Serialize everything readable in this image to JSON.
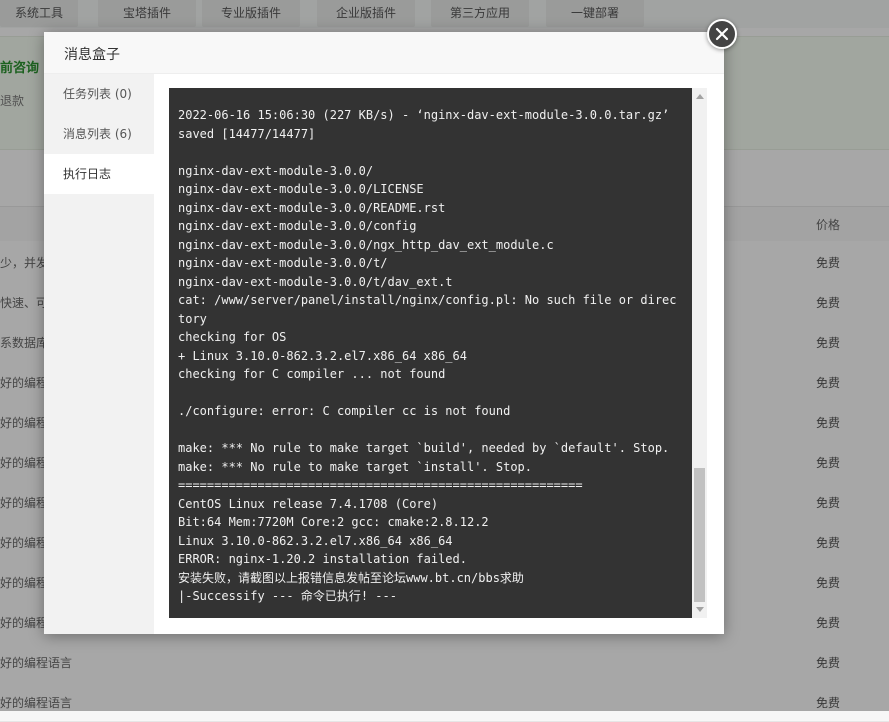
{
  "top_tabs": [
    "系统工具",
    "宝塔插件",
    "专业版插件",
    "企业版插件",
    "第三方应用",
    "一键部署"
  ],
  "consult": {
    "title": "前咨询",
    "subtitle": "退款"
  },
  "table": {
    "price_header": "价格",
    "rows": [
      {
        "desc": "少，并发",
        "price": "免费"
      },
      {
        "desc": "快速、可靠",
        "price": "免费"
      },
      {
        "desc": "系数据库",
        "price": "免费"
      },
      {
        "desc": "好的编程语",
        "price": "免费"
      },
      {
        "desc": "好的编程语",
        "price": "免费"
      },
      {
        "desc": "好的编程语",
        "price": "免费"
      },
      {
        "desc": "好的编程语",
        "price": "免费"
      },
      {
        "desc": "好的编程语",
        "price": "免费"
      },
      {
        "desc": "好的编程语",
        "price": "免费"
      },
      {
        "desc": "好的编程语",
        "price": "免费"
      },
      {
        "desc": "好的编程语言",
        "price": "免费"
      },
      {
        "desc": "好的编程语言",
        "price": "免费"
      }
    ]
  },
  "modal": {
    "title": "消息盒子",
    "nav": [
      {
        "label": "任务列表 (0)"
      },
      {
        "label": "消息列表 (6)"
      },
      {
        "label": "执行日志"
      }
    ],
    "active_nav": 2,
    "log_lines": [
      "2022-06-16 15:06:30 (227 KB/s) - ‘nginx-dav-ext-module-3.0.0.tar.gz’ saved [14477/14477]",
      "",
      "nginx-dav-ext-module-3.0.0/",
      "nginx-dav-ext-module-3.0.0/LICENSE",
      "nginx-dav-ext-module-3.0.0/README.rst",
      "nginx-dav-ext-module-3.0.0/config",
      "nginx-dav-ext-module-3.0.0/ngx_http_dav_ext_module.c",
      "nginx-dav-ext-module-3.0.0/t/",
      "nginx-dav-ext-module-3.0.0/t/dav_ext.t",
      "cat: /www/server/panel/install/nginx/config.pl: No such file or directory",
      "checking for OS",
      "+ Linux 3.10.0-862.3.2.el7.x86_64 x86_64",
      "checking for C compiler ... not found",
      "",
      "./configure: error: C compiler cc is not found",
      "",
      "make: *** No rule to make target `build', needed by `default'. Stop.",
      "make: *** No rule to make target `install'. Stop.",
      "========================================================",
      "CentOS Linux release 7.4.1708 (Core)",
      "Bit:64 Mem:7720M Core:2 gcc: cmake:2.8.12.2",
      "Linux 3.10.0-862.3.2.el7.x86_64 x86_64",
      "ERROR: nginx-1.20.2 installation failed.",
      "安装失败，请截图以上报错信息发帖至论坛www.bt.cn/bbs求助",
      "|-Successify --- 命令已执行! ---"
    ]
  },
  "colors": {
    "terminal_bg": "#333333",
    "terminal_text": "#f0f0f0",
    "consult_green": "#2a8f2f",
    "close_button": "#444444"
  },
  "icons": {
    "close": "close-icon"
  }
}
